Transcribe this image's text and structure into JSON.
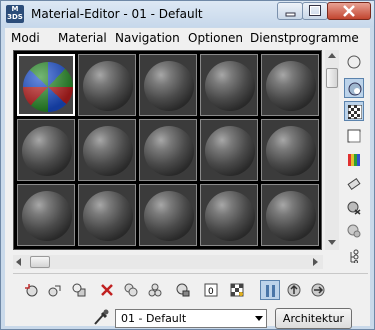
{
  "window": {
    "app_icon_text": "M 3DS",
    "title": "Material-Editor - 01 - Default"
  },
  "menu": {
    "items": [
      {
        "label": "Modi"
      },
      {
        "label": "Material"
      },
      {
        "label": "Navigation"
      },
      {
        "label": "Optionen"
      },
      {
        "label": "Dienstprogramme"
      }
    ]
  },
  "material_slots": {
    "rows": 3,
    "columns": 5,
    "active_slot": 1
  },
  "side_toolbar": [
    {
      "icon": "sample-type-sphere-icon",
      "selected": false
    },
    {
      "icon": "backlight-icon",
      "selected": true
    },
    {
      "icon": "background-checker-icon",
      "selected": true
    },
    {
      "icon": "sample-uv-tiling-icon",
      "selected": false
    },
    {
      "icon": "video-color-check-icon",
      "selected": false
    },
    {
      "icon": "make-preview-icon",
      "selected": false
    },
    {
      "icon": "material-options-icon",
      "selected": false
    },
    {
      "icon": "select-by-material-icon",
      "selected": false
    },
    {
      "icon": "material-map-navigator-icon",
      "selected": false
    }
  ],
  "bottom_toolbar": [
    {
      "icon": "get-material-icon",
      "selected": false
    },
    {
      "icon": "put-to-scene-icon",
      "selected": false
    },
    {
      "icon": "assign-to-selection-icon",
      "selected": false
    },
    {
      "icon": "reset-map-icon",
      "selected": false
    },
    {
      "icon": "make-copy-icon",
      "selected": false
    },
    {
      "icon": "make-unique-icon",
      "selected": false
    },
    {
      "icon": "put-to-library-icon",
      "selected": false
    },
    {
      "icon": "material-id-channel-icon",
      "selected": false
    },
    {
      "icon": "show-map-in-viewport-icon",
      "selected": false
    },
    {
      "icon": "show-end-result-icon",
      "selected": true
    },
    {
      "icon": "go-to-parent-icon",
      "selected": false
    },
    {
      "icon": "go-forward-to-sibling-icon",
      "selected": false
    }
  ],
  "material_bar": {
    "picker_icon": "eyedropper-icon",
    "material_name": "01 - Default",
    "type_button": "Architektur"
  },
  "colors": {
    "title_bar": "#c7d8eb",
    "window_bg": "#f0f0f0",
    "close_button": "#c2452f",
    "slot_bg": "#3b3b3b",
    "selected_button": "#bcd3ea"
  }
}
